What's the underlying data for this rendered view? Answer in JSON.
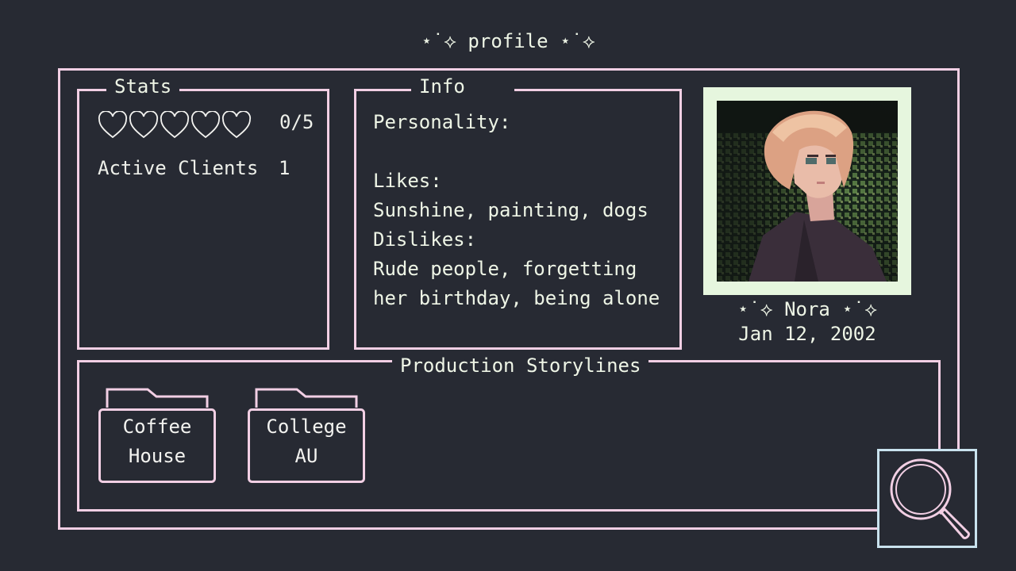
{
  "header": {
    "title": "⋆˙⟡ profile ⋆˙⟡"
  },
  "stats": {
    "legend": "Stats",
    "hearts_filled": 0,
    "hearts_total": 5,
    "hearts_text": "0/5",
    "active_clients_label": "Active Clients",
    "active_clients_value": "1"
  },
  "info": {
    "legend": "Info",
    "personality_label": "Personality:",
    "likes_label": "Likes:",
    "likes_value": "Sunshine, painting, dogs",
    "dislikes_label": "Dislikes:",
    "dislikes_line1": "Rude people, forgetting",
    "dislikes_line2": "her birthday, being alone"
  },
  "character": {
    "name_line": "⋆˙⟡ Nora ⋆˙⟡",
    "birthday": "Jan 12, 2002"
  },
  "storylines": {
    "legend": "Production Storylines",
    "folders": [
      {
        "line1": "Coffee",
        "line2": "House"
      },
      {
        "line1": "College",
        "line2": "AU"
      }
    ]
  },
  "icons": {
    "search": "magnifier-icon",
    "folder": "folder-icon",
    "heart": "heart-outline-icon"
  },
  "colors": {
    "background": "#272a33",
    "frame_pink": "#f2cfe4",
    "photo_border": "#e6f6de",
    "search_border": "#c9e2ee",
    "text": "#eef5e6"
  }
}
